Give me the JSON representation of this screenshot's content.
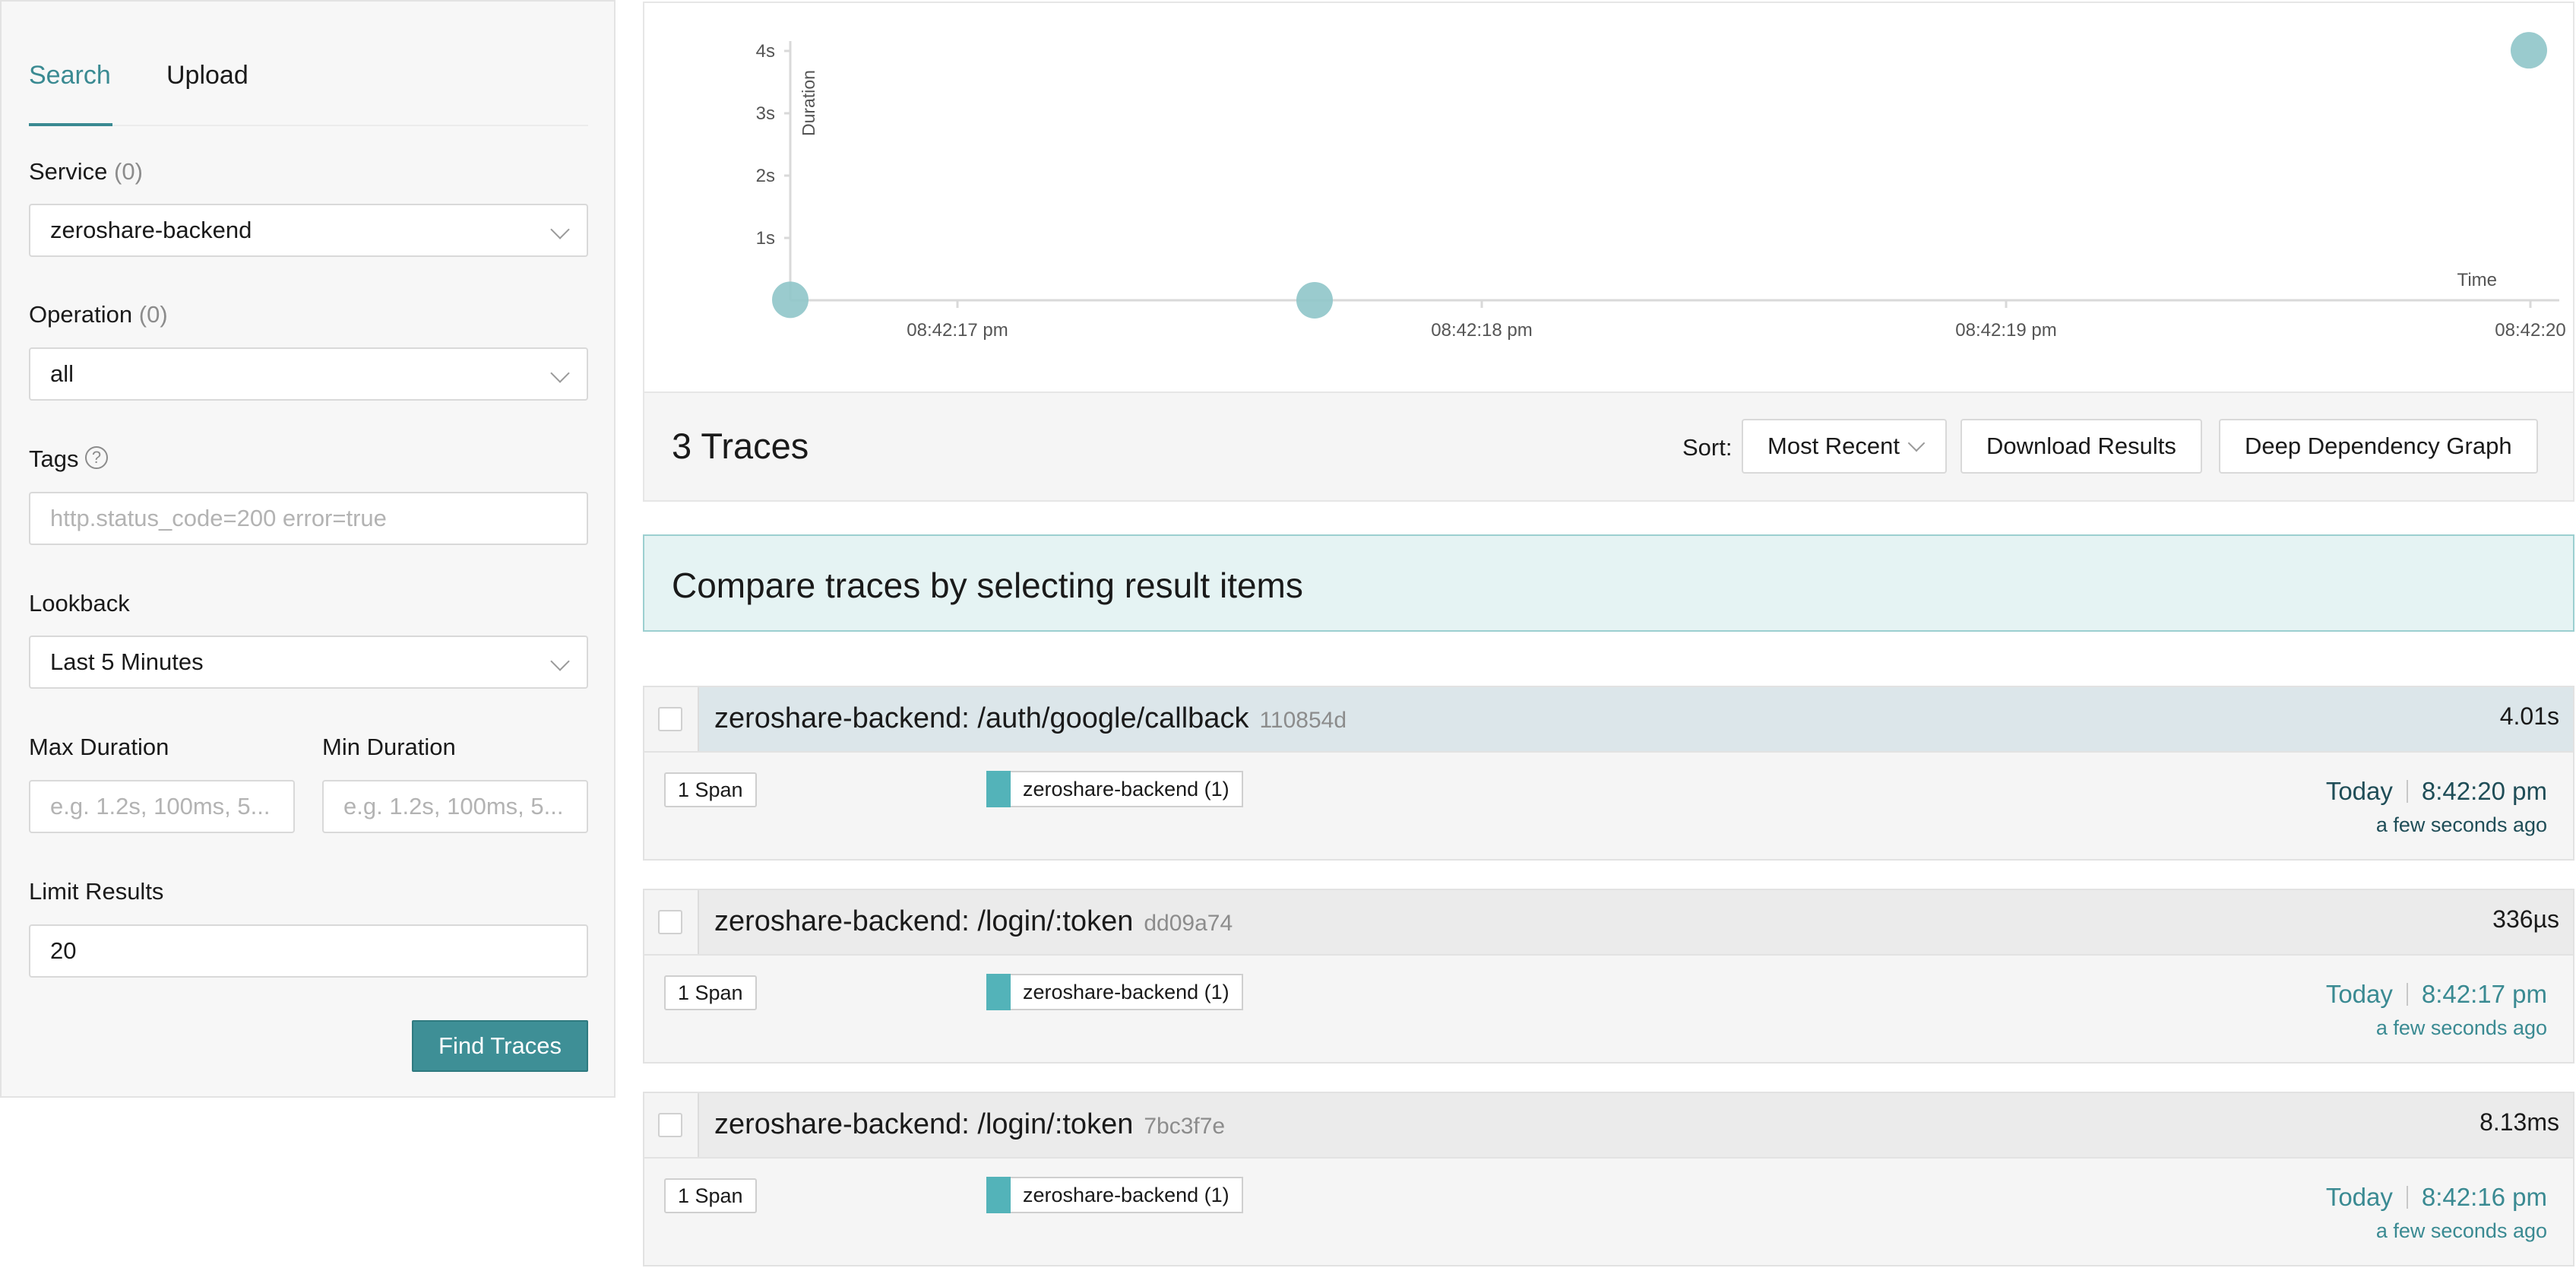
{
  "tabs": {
    "search": "Search",
    "upload": "Upload"
  },
  "service": {
    "label": "Service",
    "count": "(0)",
    "value": "zeroshare-backend"
  },
  "operation": {
    "label": "Operation",
    "count": "(0)",
    "value": "all"
  },
  "tags": {
    "label": "Tags",
    "help": "?",
    "placeholder": "http.status_code=200 error=true"
  },
  "lookback": {
    "label": "Lookback",
    "value": "Last 5 Minutes"
  },
  "max_duration": {
    "label": "Max Duration",
    "placeholder": "e.g. 1.2s, 100ms, 5..."
  },
  "min_duration": {
    "label": "Min Duration",
    "placeholder": "e.g. 1.2s, 100ms, 5..."
  },
  "limit": {
    "label": "Limit Results",
    "value": "20"
  },
  "find_button": "Find Traces",
  "chart_data": {
    "type": "scatter",
    "ylabel": "Duration",
    "xlabel": "Time",
    "y_ticks": [
      "1s",
      "2s",
      "3s",
      "4s"
    ],
    "x_ticks": [
      "08:42:17 pm",
      "08:42:18 pm",
      "08:42:19 pm",
      "08:42:20"
    ],
    "ylim": [
      0,
      4
    ],
    "points": [
      {
        "x": "08:42:16 pm",
        "y": 0.00813
      },
      {
        "x": "08:42:17 pm",
        "y": 0.000336
      },
      {
        "x": "08:42:20 pm",
        "y": 4.01
      }
    ],
    "color": "#8fc5c9"
  },
  "results": {
    "count_text": "3 Traces",
    "sort_label": "Sort:",
    "sort_value": "Most Recent",
    "download": "Download Results",
    "ddg": "Deep Dependency Graph"
  },
  "compare_banner": "Compare traces by selecting result items",
  "traces": [
    {
      "name": "zeroshare-backend: /auth/google/callback",
      "id": "110854d",
      "duration": "4.01s",
      "spans": "1 Span",
      "service": "zeroshare-backend (1)",
      "day": "Today",
      "time": "8:42:20 pm",
      "ago": "a few seconds ago"
    },
    {
      "name": "zeroshare-backend: /login/:token",
      "id": "dd09a74",
      "duration": "336µs",
      "spans": "1 Span",
      "service": "zeroshare-backend (1)",
      "day": "Today",
      "time": "8:42:17 pm",
      "ago": "a few seconds ago"
    },
    {
      "name": "zeroshare-backend: /login/:token",
      "id": "7bc3f7e",
      "duration": "8.13ms",
      "spans": "1 Span",
      "service": "zeroshare-backend (1)",
      "day": "Today",
      "time": "8:42:16 pm",
      "ago": "a few seconds ago"
    }
  ],
  "colors": {
    "accent": "#3a8a92",
    "button": "#3e8f96",
    "service_swatch": "#53b3b9"
  }
}
